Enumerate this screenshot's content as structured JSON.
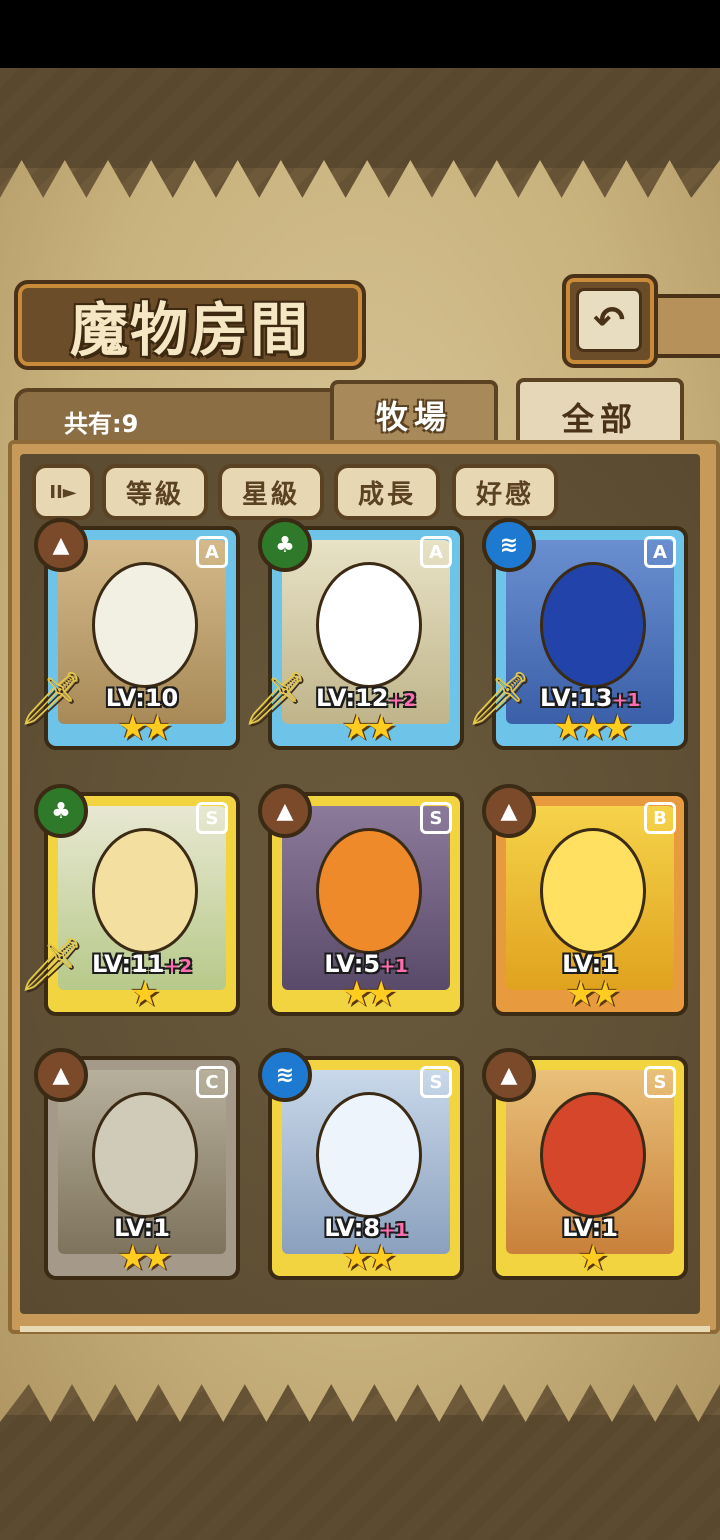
{
  "header": {
    "title": "魔物房間",
    "back_icon": "↶"
  },
  "summary": {
    "count_label": "共有:9"
  },
  "tabs": [
    {
      "label": "牧場",
      "active": false
    },
    {
      "label": "全部",
      "active": true
    }
  ],
  "sort_buttons": [
    {
      "label": "等級"
    },
    {
      "label": "星級"
    },
    {
      "label": "成長"
    },
    {
      "label": "好感"
    }
  ],
  "sort_toggle_icon": "II►",
  "monsters": [
    {
      "rank": "A",
      "element": "earth",
      "level": "LV:10",
      "bonus": "",
      "stars": "★★",
      "equipped": true
    },
    {
      "rank": "A",
      "element": "wood",
      "level": "LV:12",
      "bonus": "+2",
      "stars": "★★",
      "equipped": true
    },
    {
      "rank": "A",
      "element": "water",
      "level": "LV:13",
      "bonus": "+1",
      "stars": "★★★",
      "equipped": true
    },
    {
      "rank": "S",
      "element": "wood",
      "level": "LV:11",
      "bonus": "+2",
      "stars": "★",
      "equipped": true
    },
    {
      "rank": "S",
      "element": "earth",
      "level": "LV:5",
      "bonus": "+1",
      "stars": "★★",
      "equipped": false
    },
    {
      "rank": "B",
      "element": "earth",
      "level": "LV:1",
      "bonus": "",
      "stars": "★★",
      "equipped": false
    },
    {
      "rank": "C",
      "element": "earth",
      "level": "LV:1",
      "bonus": "",
      "stars": "★★",
      "equipped": false
    },
    {
      "rank": "S",
      "element": "water",
      "level": "LV:8",
      "bonus": "+1",
      "stars": "★★",
      "equipped": false
    },
    {
      "rank": "S",
      "element": "earth",
      "level": "LV:1",
      "bonus": "",
      "stars": "★",
      "equipped": false
    }
  ],
  "element_glyphs": {
    "earth": "▲",
    "wood": "♣",
    "water": "≋"
  },
  "sword_glyph": "🗡",
  "colors": {
    "rank_A": "#6ec4e8",
    "rank_S": "#f2d340",
    "rank_B": "#e89a3e",
    "rank_C": "#a59a8a"
  }
}
